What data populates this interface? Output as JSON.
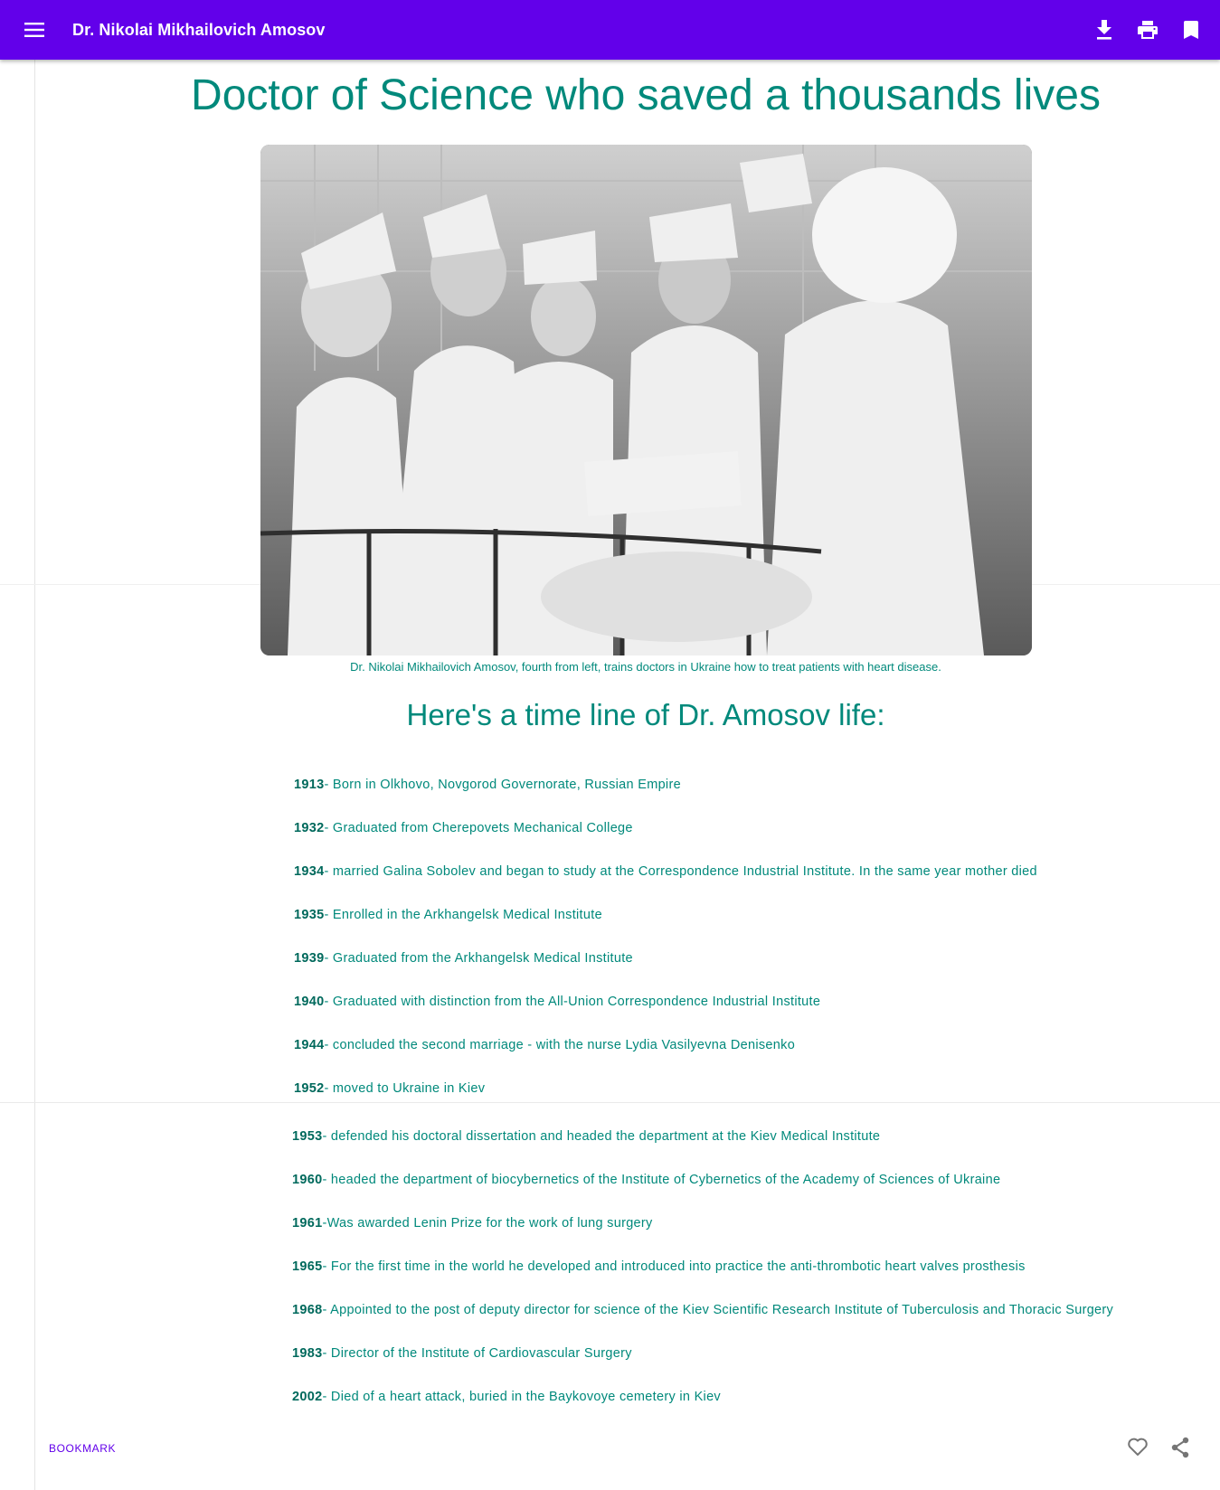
{
  "appbar": {
    "title": "Dr. Nikolai Mikhailovich Amosov",
    "icons": [
      "menu-icon",
      "download-icon",
      "print-icon",
      "bookmark-icon"
    ],
    "color": "#6200ea"
  },
  "article": {
    "headline": "Doctor of Science who saved a thousands lives",
    "caption": "Dr. Nikolai Mikhailovich Amosov, fourth from left, trains doctors in Ukraine how to treat patients with heart disease.",
    "subheading": "Here's a time line of Dr. Amosov life:",
    "accent_color": "#00897b"
  },
  "timeline": [
    {
      "year": "1913",
      "text": "- Born in Olkhovo, Novgorod Governorate, Russian Empire"
    },
    {
      "year": "1932",
      "text": "- Graduated from Cherepovets Mechanical College"
    },
    {
      "year": "1934",
      "text": "- married Galina Sobolev and began to study at the Correspondence Industrial Institute. In the same year mother died"
    },
    {
      "year": "1935",
      "text": "- Enrolled in the Arkhangelsk Medical Institute"
    },
    {
      "year": "1939",
      "text": "- Graduated from the Arkhangelsk Medical Institute"
    },
    {
      "year": "1940",
      "text": "- Graduated with distinction from the All-Union Correspondence Industrial Institute"
    },
    {
      "year": "1944",
      "text": "- concluded the second marriage - with the nurse Lydia Vasilyevna Denisenko"
    },
    {
      "year": "1952",
      "text": "- moved to Ukraine in Kiev"
    },
    {
      "year": "1953",
      "text": "- defended his doctoral dissertation and headed the department at the Kiev Medical Institute"
    },
    {
      "year": "1960",
      "text": "- headed the department of biocybernetics of the Institute of Cybernetics of the Academy of Sciences of Ukraine"
    },
    {
      "year": "1961",
      "text": "-Was awarded Lenin Prize for the work of lung surgery"
    },
    {
      "year": "1965",
      "text": "- For the first time in the world he developed and introduced into practice the anti-thrombotic heart valves prosthesis"
    },
    {
      "year": "1968",
      "text": "- Appointed to the post of deputy director for science of the Kiev Scientific Research Institute of Tuberculosis and Thoracic Surgery"
    },
    {
      "year": "1983",
      "text": "- Director of the Institute of Cardiovascular Surgery"
    },
    {
      "year": "2002",
      "text": "- Died of a heart attack, buried in the Baykovoye cemetery in Kiev"
    }
  ],
  "footer": {
    "bookmark_label": "BOOKMARK",
    "icons": [
      "heart-icon",
      "share-icon"
    ]
  }
}
